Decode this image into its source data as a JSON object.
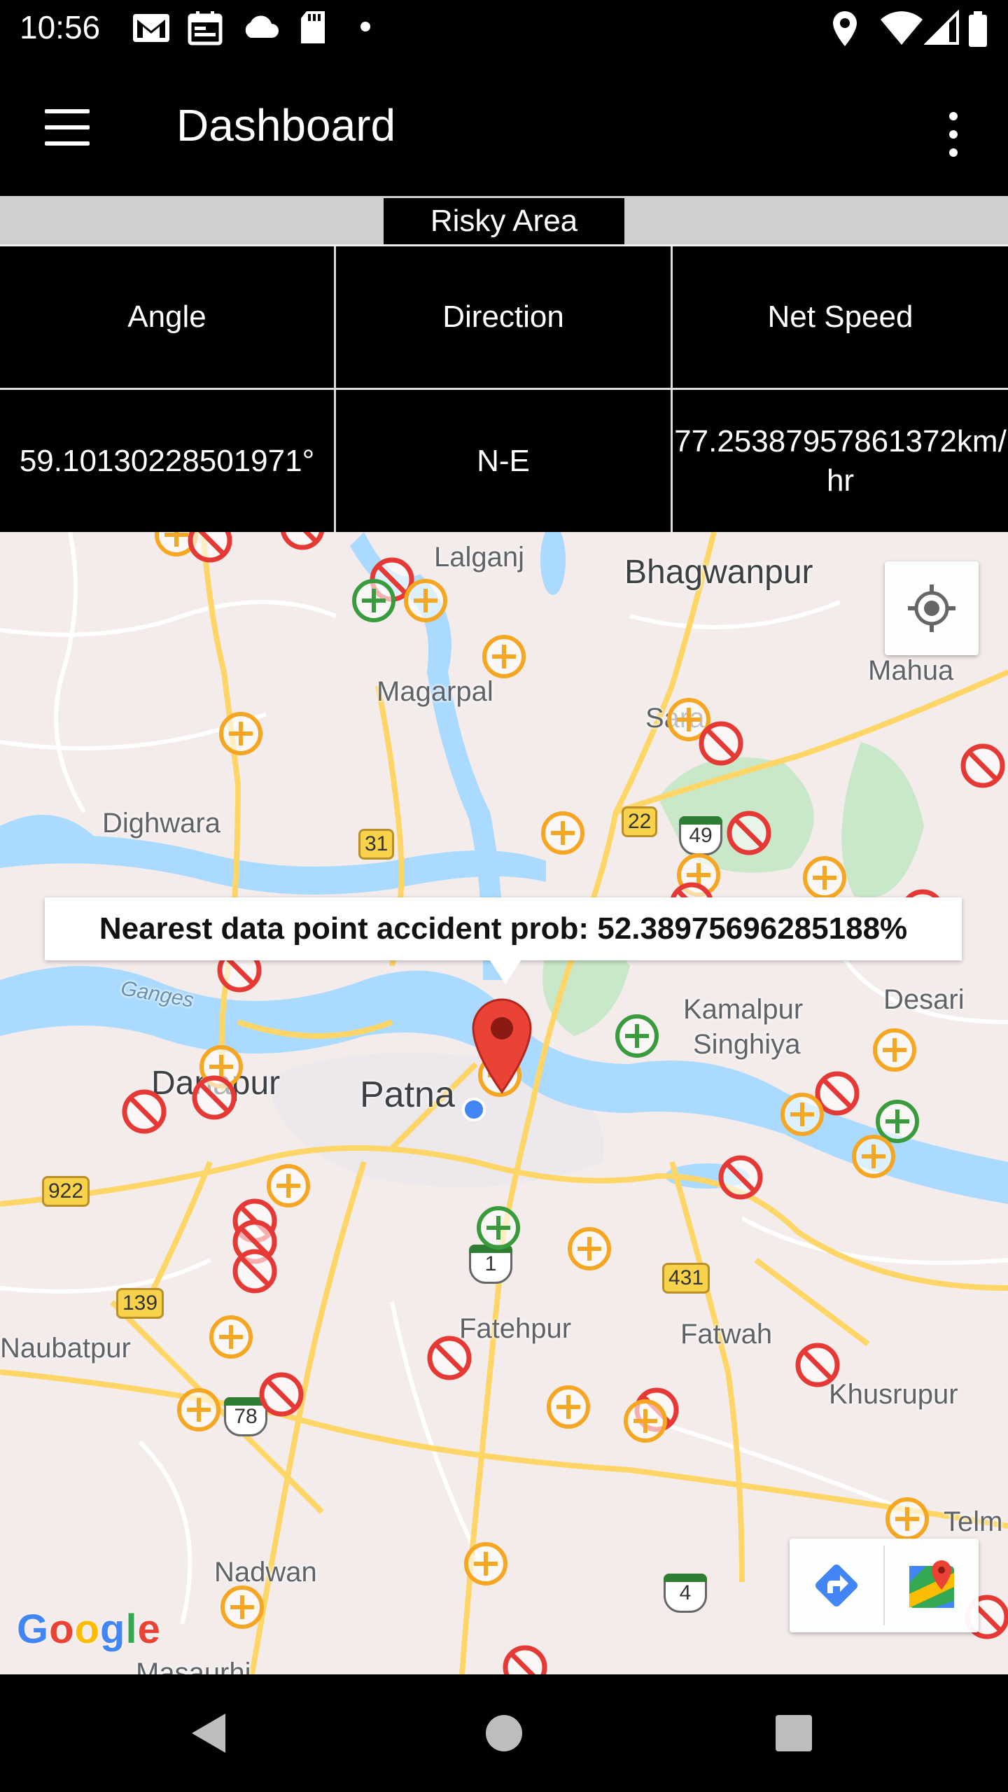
{
  "status_bar": {
    "time": "10:56",
    "icons": [
      "gmail-icon",
      "calendar-icon",
      "cloud-icon",
      "sd-card-icon",
      "dot-icon",
      "location-icon",
      "wifi-icon",
      "signal-icon",
      "battery-icon"
    ]
  },
  "app_bar": {
    "title": "Dashboard",
    "menu_icon": "hamburger-menu-icon",
    "overflow_icon": "more-vert-icon"
  },
  "risky_area": {
    "label": "Risky Area"
  },
  "table": {
    "headers": [
      "Angle",
      "Direction",
      "Net Speed"
    ],
    "values": {
      "angle": "59.10130228501971°",
      "direction": "N-E",
      "net_speed_line1": "77.25387957861372km/",
      "net_speed_line2": "hr"
    }
  },
  "map": {
    "info_window": "Nearest data point accident prob: 52.38975696285188%",
    "places": {
      "lalganj": "Lalganj",
      "bhagwanpur": "Bhagwanpur",
      "mahua": "Mahua",
      "magarpal": "Magarpal",
      "sarai": "Sara",
      "dighwara": "Dighwara",
      "ganges": "Ganges",
      "danapur": "Danapur",
      "patna": "Patna",
      "kamalpur": "Kamalpur",
      "singhiya": "Singhiya",
      "desari": "Desari",
      "fatehpur": "Fatehpur",
      "fatwah": "Fatwah",
      "khusrupur": "Khusrupur",
      "naubatpur": "Naubatpur",
      "nadwan": "Nadwan",
      "telm": "Telm",
      "masaurhi": "Masaurhi"
    },
    "road_shields": {
      "r31": "31",
      "r22": "22",
      "r922": "922",
      "r139": "139",
      "r431": "431"
    },
    "nh_shields": {
      "nh49": "49",
      "nh1": "1",
      "nh78": "78",
      "nh4": "4"
    },
    "google_logo": "Google",
    "colors": {
      "water": "#aadaff",
      "road": "#fdd667",
      "green_area": "#c9e7c9",
      "marker_orange": "#f5a623",
      "marker_green": "#3a9b3e",
      "marker_red": "#e53935",
      "pin_red": "#ea4335",
      "blue_dot": "#4285f4"
    }
  }
}
